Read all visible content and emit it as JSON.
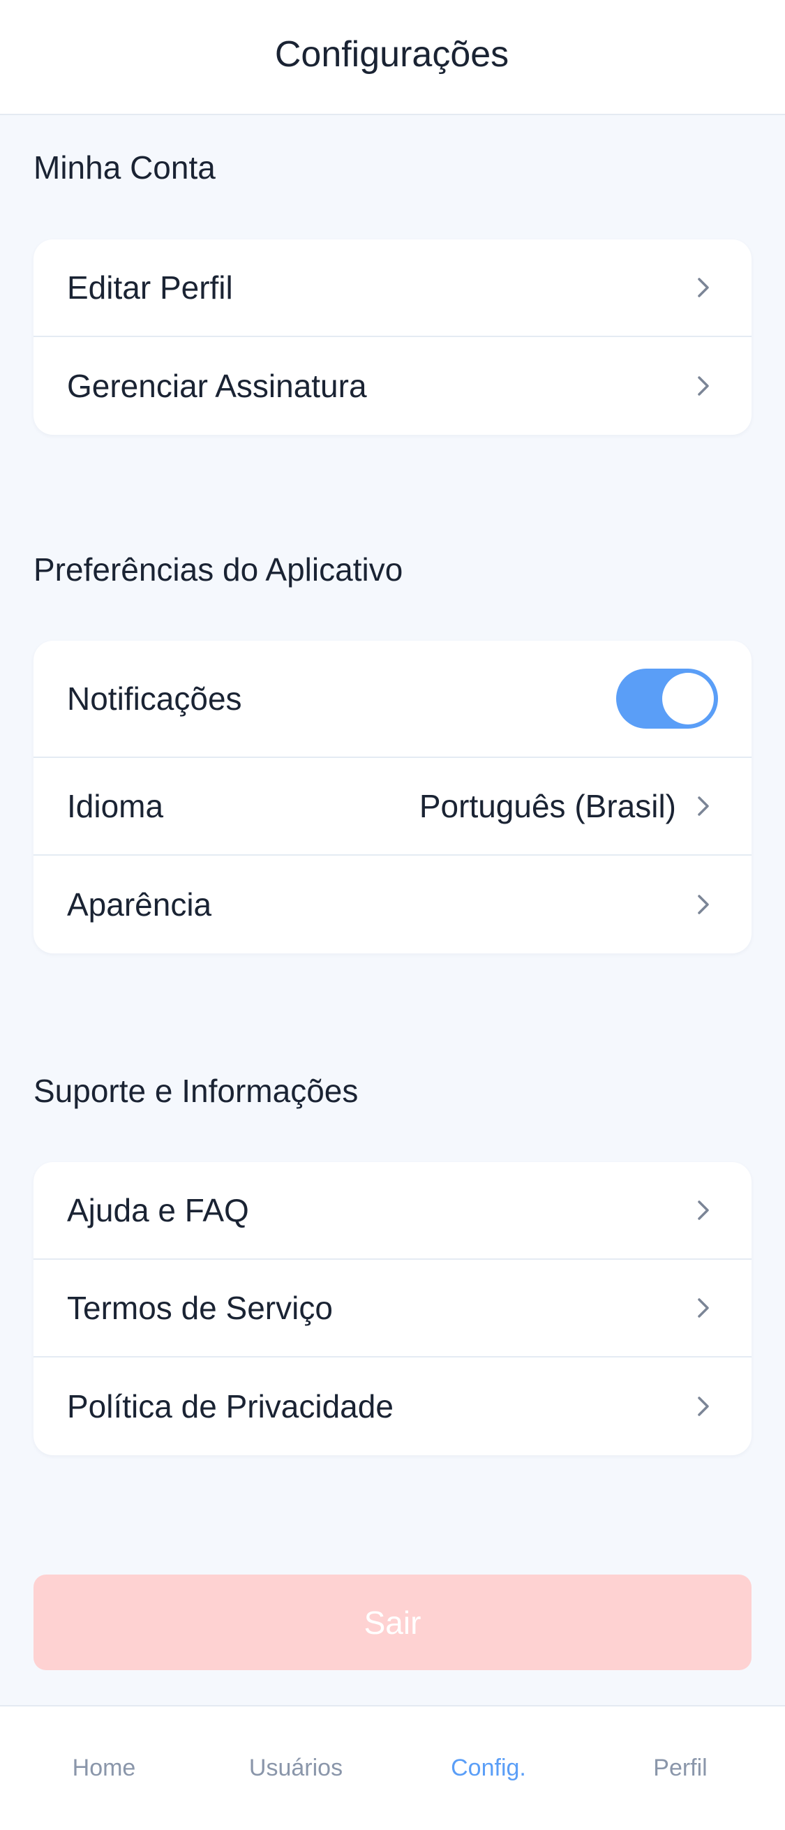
{
  "header": {
    "title": "Configurações"
  },
  "sections": {
    "account": {
      "title": "Minha Conta",
      "items": [
        {
          "label": "Editar Perfil"
        },
        {
          "label": "Gerenciar Assinatura"
        }
      ]
    },
    "preferences": {
      "title": "Preferências do Aplicativo",
      "notifications": {
        "label": "Notificações",
        "enabled": true
      },
      "language": {
        "label": "Idioma",
        "value": "Português (Brasil)"
      },
      "appearance": {
        "label": "Aparência"
      }
    },
    "support": {
      "title": "Suporte e Informações",
      "items": [
        {
          "label": "Ajuda e FAQ"
        },
        {
          "label": "Termos de Serviço"
        },
        {
          "label": "Política de Privacidade"
        }
      ]
    }
  },
  "logout": {
    "label": "Sair",
    "color": "#fed2d2"
  },
  "tabbar": {
    "active": "Config.",
    "tabs": [
      {
        "label": "Home"
      },
      {
        "label": "Usuários"
      },
      {
        "label": "Config."
      },
      {
        "label": "Perfil"
      }
    ]
  },
  "colors": {
    "accent": "#5a9ef7",
    "background": "#f5f8fd",
    "text": "#1a2333",
    "muted": "#8a96aa"
  },
  "icons": {
    "chevron": "chevron-right-icon",
    "toggle": "toggle-switch"
  }
}
